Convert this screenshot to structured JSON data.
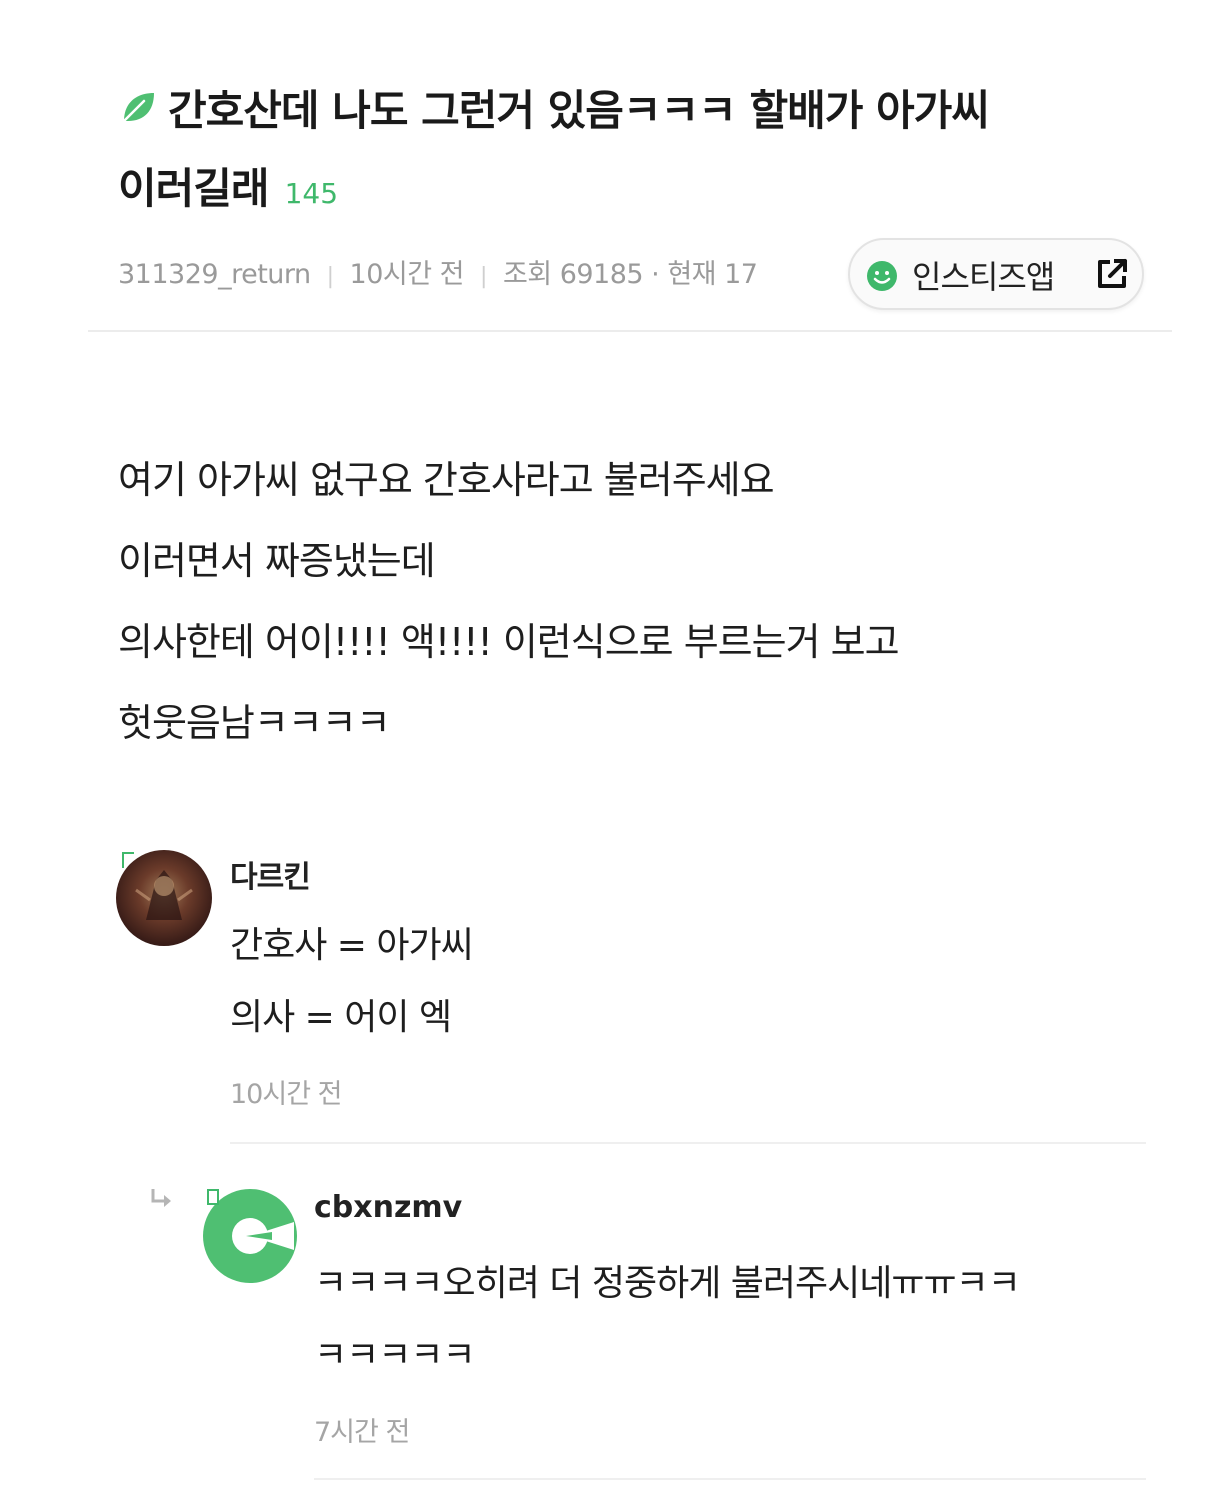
{
  "post": {
    "title_icon": "leaf-icon",
    "title_line1": "간호산데 나도 그런거 있음ㅋㅋㅋ 할배가 아가씨",
    "title_line2": "이러길래",
    "comment_count": "145",
    "author": "311329_return",
    "time": "10시간 전",
    "views": "조회 69185 · 현재 17",
    "app_button_label": "인스티즈앱",
    "body_lines": [
      "여기 아가씨 없구요 간호사라고 불러주세요",
      "이러면서 짜증냈는데",
      "의사한테 어이!!!! 액!!!! 이런식으로 부르는거 보고",
      "헛웃음남ㅋㅋㅋㅋ"
    ]
  },
  "comments": [
    {
      "author": "다르킨",
      "lines": [
        "간호사 = 아가씨",
        "의사 = 어이 엑"
      ],
      "time": "10시간 전"
    },
    {
      "author": "cbxnzmv",
      "lines": [
        "ㅋㅋㅋㅋ오히려 더 정중하게 불러주시네ㅠㅠㅋㅋ",
        "ㅋㅋㅋㅋㅋ"
      ],
      "time": "7시간 전",
      "is_reply": true
    }
  ],
  "colors": {
    "accent_green": "#3fb86b",
    "meta_gray": "#9a9a9a"
  }
}
